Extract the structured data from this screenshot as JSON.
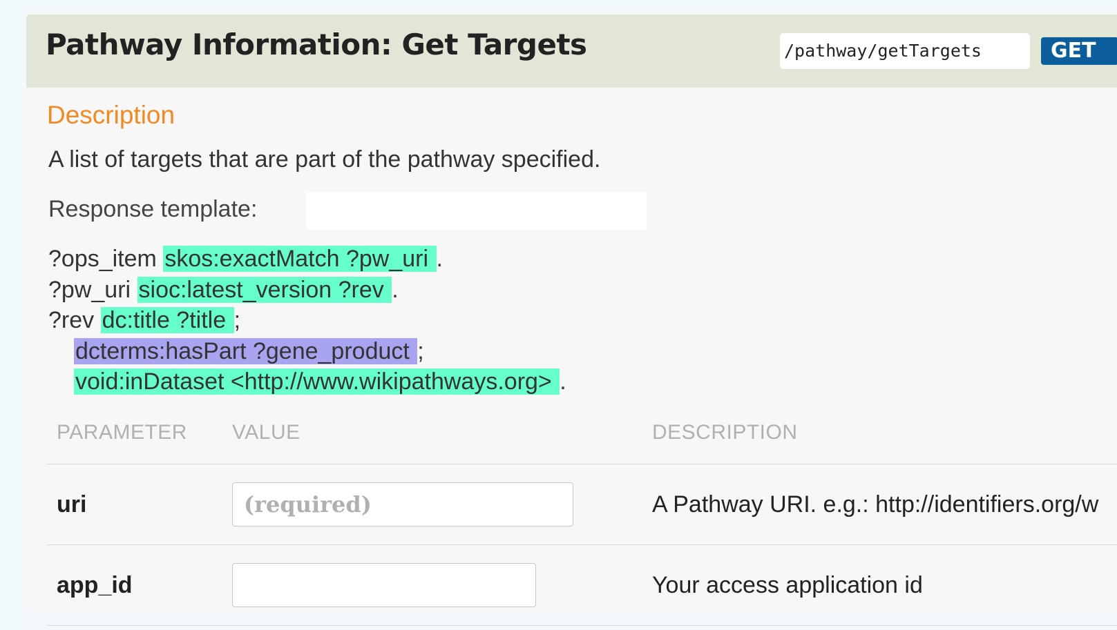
{
  "operation": {
    "title": "Pathway Information: Get Targets",
    "path": "/pathway/getTargets",
    "method": "GET"
  },
  "description": {
    "heading": "Description",
    "text": "A list of targets that are part of the pathway specified."
  },
  "response_template": {
    "label": "Response template:",
    "selected": ""
  },
  "template_lines": [
    {
      "prefix": "?ops_item ",
      "highlight": "skos:exactMatch ?pw_uri ",
      "suffix": "."
    },
    {
      "prefix": "?pw_uri ",
      "highlight": "sioc:latest_version ?rev ",
      "suffix": "."
    },
    {
      "prefix": "?rev ",
      "highlight": "dc:title ?title ",
      "suffix": ";"
    },
    {
      "prefix": "",
      "highlight": "dcterms:hasPart ?gene_product ",
      "suffix": ";"
    },
    {
      "prefix": "",
      "highlight": "void:inDataset <http://www.wikipathways.org> ",
      "suffix": "."
    }
  ],
  "colors": {
    "highlight_green": "#66ffcc",
    "highlight_purple": "#a8a4f0",
    "method_badge": "#0c5d9c",
    "description_heading": "#f08a24"
  },
  "params_table": {
    "headers": [
      "PARAMETER",
      "VALUE",
      "DESCRIPTION"
    ],
    "rows": [
      {
        "name": "uri",
        "value": "",
        "placeholder": "(required)",
        "description": "A Pathway URI. e.g.: http://identifiers.org/w"
      },
      {
        "name": "app_id",
        "value": "",
        "placeholder": "",
        "description": "Your access application id"
      }
    ]
  }
}
